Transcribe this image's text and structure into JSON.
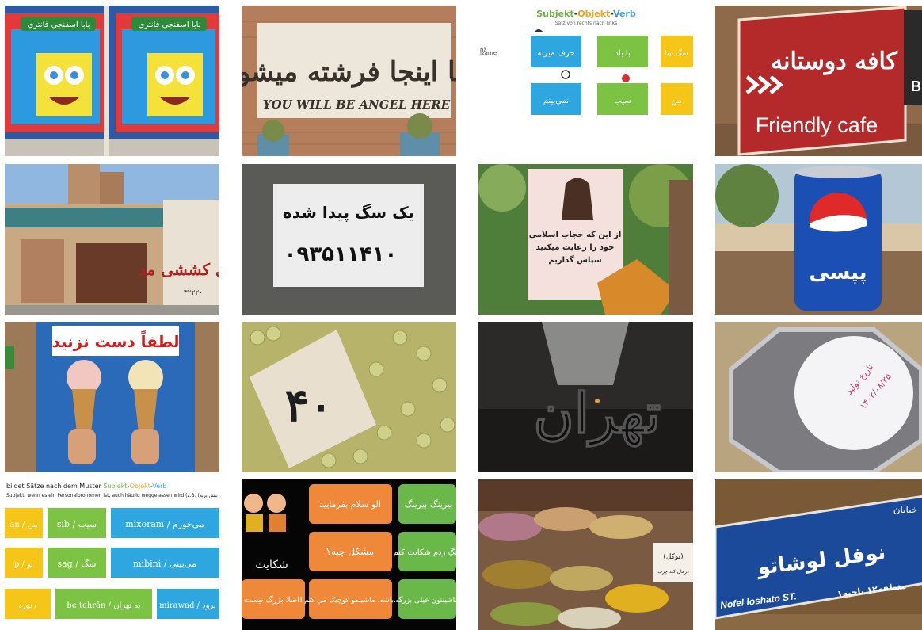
{
  "tiles": [
    {
      "id": "spongebob",
      "sign_text": "بابا اسفنجی فانتزی"
    },
    {
      "id": "angel",
      "fa": "شما اینجا فرشته میشوید",
      "en": "YOU WILL BE ANGEL HERE"
    },
    {
      "id": "svo",
      "title_parts": [
        "Subjekt",
        "-",
        "Objekt",
        "-",
        "Verb"
      ],
      "subtitle": "Satz von rechts nach links",
      "left1": "nä",
      "left2": "izame",
      "cards": [
        "حرف میزنه",
        "با باد",
        "سگ تینا",
        "نمی‌بینم",
        "سیب",
        "من"
      ]
    },
    {
      "id": "cafe",
      "fa": "کافه دوستانه",
      "en": "Friendly cafe",
      "partial": "Bi"
    },
    {
      "id": "street",
      "fa": "کاری کششی مد",
      "num": "۳۲۲۲۰"
    },
    {
      "id": "dog",
      "line1": "یک سگ پیدا شده",
      "line2": "۰۹۳۵۱۱۴۱۰"
    },
    {
      "id": "hijab",
      "line1": "از این که حجاب اسلامی",
      "line2": "خود را رعایت میکنید",
      "line3": "سپاس گذاریم"
    },
    {
      "id": "pepsi",
      "text": "پپسی"
    },
    {
      "id": "icecream",
      "text": "لطفاً دست نزنید"
    },
    {
      "id": "grapes",
      "text": "۴۰"
    },
    {
      "id": "tehran",
      "text": "تهران"
    },
    {
      "id": "egg",
      "stamp1": "تاریخ تولید",
      "stamp2": "۱۴۰۲/۰۸/۲۵"
    },
    {
      "id": "worksheet",
      "header1": "bildet Sätze nach dem Muster ",
      "header_svo": [
        "Subjekt",
        "-",
        "Objekt",
        "-",
        "Verb"
      ],
      "header2": "Subjekt, wenn es ein Personalpronomen ist, auch häufig weggelassen wird (z.B.",
      "header2_fa": "(بیش بربه",
      "rows": [
        {
          "a": "an / من",
          "b": "sib / سیب",
          "c": "mixoram / می‌خورم"
        },
        {
          "a": "p / تو",
          "b": "sag / سگ",
          "c": "mibini / می‌بینی"
        },
        {
          "a": "دورو / ",
          "b": "be tehrān / به تهران",
          "c": "mirawad / برود"
        }
      ]
    },
    {
      "id": "dialog",
      "cells": [
        "الو سلام بفرمایید",
        "بیرینگ بیرینگ",
        "مشکل چیه؟",
        "زنگ زدم شکایت کنم.",
        "باشه. ماشینمو کوچیک می کنم.",
        "ماشینتون خیلی بزرگه!",
        "اصلا بزرگ نیست!"
      ],
      "title": "شکایت"
    },
    {
      "id": "spices",
      "label": "(بوکل)",
      "sub": "درمان کبد چرب"
    },
    {
      "id": "streetsign",
      "top": "خیابان",
      "main": "نوفل لوشاتو",
      "latin": "Nofel loshato ST.",
      "district": "منطقه۱۲ ناحیه۱"
    }
  ]
}
